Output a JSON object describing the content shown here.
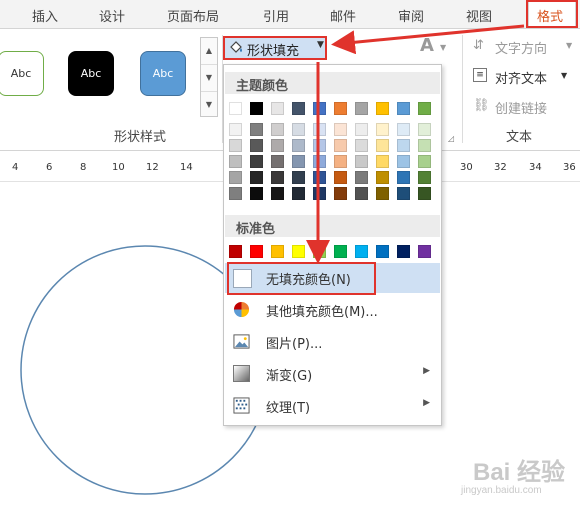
{
  "tabs": [
    "插入",
    "设计",
    "页面布局",
    "引用",
    "邮件",
    "审阅",
    "视图"
  ],
  "active_tab": "格式",
  "shape_styles": {
    "items": [
      {
        "label": "Abc",
        "style": "outline-green"
      },
      {
        "label": "Abc",
        "style": "black"
      },
      {
        "label": "Abc",
        "style": "blue"
      }
    ],
    "group_label": "形状样式"
  },
  "fill_button": {
    "label": "形状填充"
  },
  "text_group": {
    "direction": "文字方向",
    "align": "对齐文本",
    "link": "创建链接",
    "group_label": "文本",
    "font_glyph": "A"
  },
  "ruler": {
    "left": [
      "4",
      "6",
      "8",
      "10",
      "12",
      "14"
    ],
    "right": [
      "30",
      "32",
      "34",
      "36"
    ]
  },
  "dropdown": {
    "theme_header": "主题颜色",
    "standard_header": "标准色",
    "no_fill": "无填充颜色(N)",
    "more_colors": "其他填充颜色(M)...",
    "picture": "图片(P)...",
    "gradient": "渐变(G)",
    "texture": "纹理(T)"
  },
  "theme_colors": [
    "#FFFFFF",
    "#000000",
    "#E7E6E6",
    "#44546A",
    "#4472C4",
    "#ED7D31",
    "#A5A5A5",
    "#FFC000",
    "#5B9BD5",
    "#70AD47"
  ],
  "theme_tints": [
    [
      "#F2F2F2",
      "#7F7F7F",
      "#D0CECE",
      "#D6DCE4",
      "#D9E2F3",
      "#FBE4D5",
      "#EDEDED",
      "#FFF2CC",
      "#DEEBF6",
      "#E2EFD9"
    ],
    [
      "#D8D8D8",
      "#595959",
      "#AEAAAA",
      "#ADB9CA",
      "#B4C6E7",
      "#F7CAAC",
      "#DBDBDB",
      "#FEE599",
      "#BDD7EE",
      "#C5E0B3"
    ],
    [
      "#BFBFBF",
      "#3F3F3F",
      "#757070",
      "#8496B0",
      "#8EAADB",
      "#F4B183",
      "#C9C9C9",
      "#FFD965",
      "#9CC3E5",
      "#A8D08D"
    ],
    [
      "#A5A5A5",
      "#262626",
      "#3A3838",
      "#323F4F",
      "#2F5496",
      "#C55A11",
      "#7B7B7B",
      "#BF8F00",
      "#2E75B5",
      "#538135"
    ],
    [
      "#7F7F7F",
      "#0C0C0C",
      "#171616",
      "#222A35",
      "#1F3864",
      "#833C0B",
      "#525252",
      "#7F6000",
      "#1E4E79",
      "#375623"
    ]
  ],
  "standard_colors": [
    "#C00000",
    "#FF0000",
    "#FFC000",
    "#FFFF00",
    "#92D050",
    "#00B050",
    "#00B0F0",
    "#0070C0",
    "#002060",
    "#7030A0"
  ],
  "accent_red": "#E0332C",
  "circle_color": "#5B87B0",
  "watermark": {
    "text": "Bai 经验",
    "url": "jingyan.baidu.com"
  }
}
